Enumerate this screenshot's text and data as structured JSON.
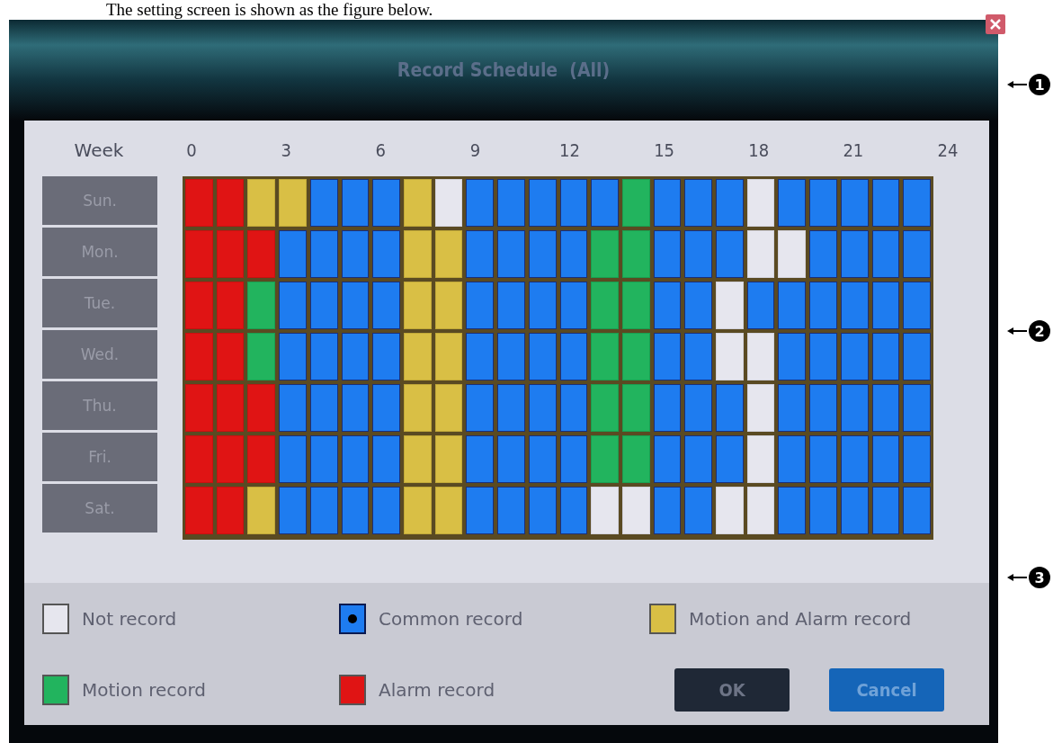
{
  "caption": "The setting screen is shown as the figure below.",
  "window": {
    "title": "Record Schedule  (All)"
  },
  "schedule": {
    "corner_label": "Week",
    "hour_labels": [
      "0",
      "3",
      "6",
      "9",
      "12",
      "15",
      "18",
      "21",
      "24"
    ],
    "rows": [
      {
        "day": "Sun.",
        "slots": [
          {
            "kind": "A"
          },
          {
            "kind": "A"
          },
          {
            "kind": "Y"
          },
          {
            "kind": "Y"
          },
          {
            "kind": "C"
          },
          {
            "kind": "C"
          },
          {
            "kind": "C"
          },
          {
            "kind": "Y"
          },
          {
            "kind": "N"
          },
          {
            "kind": "C"
          },
          {
            "kind": "C"
          },
          {
            "kind": "C"
          },
          {
            "kind": "C"
          },
          {
            "kind": "C"
          },
          {
            "kind": "G"
          },
          {
            "kind": "C"
          },
          {
            "kind": "C"
          },
          {
            "kind": "C"
          },
          {
            "kind": "N"
          },
          {
            "kind": "C"
          },
          {
            "kind": "C"
          },
          {
            "kind": "C"
          },
          {
            "kind": "C"
          },
          {
            "kind": "C"
          }
        ]
      },
      {
        "day": "Mon.",
        "slots": [
          {
            "kind": "A"
          },
          {
            "kind": "A"
          },
          {
            "kind": "A"
          },
          {
            "kind": "C"
          },
          {
            "kind": "C"
          },
          {
            "kind": "C"
          },
          {
            "kind": "C"
          },
          {
            "kind": "Y"
          },
          {
            "kind": "Y"
          },
          {
            "kind": "C"
          },
          {
            "kind": "C"
          },
          {
            "kind": "C"
          },
          {
            "kind": "C"
          },
          {
            "kind": "G"
          },
          {
            "kind": "G"
          },
          {
            "kind": "C"
          },
          {
            "kind": "C"
          },
          {
            "kind": "C"
          },
          {
            "kind": "N"
          },
          {
            "kind": "N"
          },
          {
            "kind": "C"
          },
          {
            "kind": "C"
          },
          {
            "kind": "C"
          },
          {
            "kind": "C"
          }
        ]
      },
      {
        "day": "Tue.",
        "slots": [
          {
            "kind": "A"
          },
          {
            "kind": "A"
          },
          {
            "kind": "G"
          },
          {
            "kind": "C"
          },
          {
            "kind": "C"
          },
          {
            "kind": "C"
          },
          {
            "kind": "C"
          },
          {
            "kind": "Y"
          },
          {
            "kind": "Y"
          },
          {
            "kind": "C"
          },
          {
            "kind": "C"
          },
          {
            "kind": "C"
          },
          {
            "kind": "C"
          },
          {
            "kind": "G"
          },
          {
            "kind": "G"
          },
          {
            "kind": "C"
          },
          {
            "kind": "C"
          },
          {
            "kind": "N"
          },
          {
            "kind": "C"
          },
          {
            "kind": "C"
          },
          {
            "kind": "C"
          },
          {
            "kind": "C"
          },
          {
            "kind": "C"
          },
          {
            "kind": "C"
          }
        ]
      },
      {
        "day": "Wed.",
        "slots": [
          {
            "kind": "A"
          },
          {
            "kind": "A"
          },
          {
            "kind": "G"
          },
          {
            "kind": "C"
          },
          {
            "kind": "C"
          },
          {
            "kind": "C"
          },
          {
            "kind": "C"
          },
          {
            "kind": "Y"
          },
          {
            "kind": "Y"
          },
          {
            "kind": "C"
          },
          {
            "kind": "C"
          },
          {
            "kind": "C"
          },
          {
            "kind": "C"
          },
          {
            "kind": "G"
          },
          {
            "kind": "G"
          },
          {
            "kind": "C"
          },
          {
            "kind": "C"
          },
          {
            "kind": "N"
          },
          {
            "kind": "N"
          },
          {
            "kind": "C"
          },
          {
            "kind": "C"
          },
          {
            "kind": "C"
          },
          {
            "kind": "C"
          },
          {
            "kind": "C"
          }
        ]
      },
      {
        "day": "Thu.",
        "slots": [
          {
            "kind": "A"
          },
          {
            "kind": "A"
          },
          {
            "kind": "A"
          },
          {
            "kind": "C"
          },
          {
            "kind": "C"
          },
          {
            "kind": "C"
          },
          {
            "kind": "C"
          },
          {
            "kind": "Y"
          },
          {
            "kind": "Y"
          },
          {
            "kind": "C"
          },
          {
            "kind": "C"
          },
          {
            "kind": "C"
          },
          {
            "kind": "C"
          },
          {
            "kind": "G"
          },
          {
            "kind": "G"
          },
          {
            "kind": "C"
          },
          {
            "kind": "C"
          },
          {
            "kind": "C"
          },
          {
            "kind": "N"
          },
          {
            "kind": "C"
          },
          {
            "kind": "C"
          },
          {
            "kind": "C"
          },
          {
            "kind": "C"
          },
          {
            "kind": "C"
          }
        ]
      },
      {
        "day": "Fri.",
        "slots": [
          {
            "kind": "A"
          },
          {
            "kind": "A"
          },
          {
            "kind": "A"
          },
          {
            "kind": "C"
          },
          {
            "kind": "C"
          },
          {
            "kind": "C"
          },
          {
            "kind": "C"
          },
          {
            "kind": "Y"
          },
          {
            "kind": "Y"
          },
          {
            "kind": "C"
          },
          {
            "kind": "C"
          },
          {
            "kind": "C"
          },
          {
            "kind": "C"
          },
          {
            "kind": "G"
          },
          {
            "kind": "G"
          },
          {
            "kind": "C"
          },
          {
            "kind": "C"
          },
          {
            "kind": "C"
          },
          {
            "kind": "N"
          },
          {
            "kind": "C"
          },
          {
            "kind": "C"
          },
          {
            "kind": "C"
          },
          {
            "kind": "C"
          },
          {
            "kind": "C"
          }
        ]
      },
      {
        "day": "Sat.",
        "slots": [
          {
            "kind": "A"
          },
          {
            "kind": "A"
          },
          {
            "kind": "Y"
          },
          {
            "kind": "C"
          },
          {
            "kind": "C"
          },
          {
            "kind": "C"
          },
          {
            "kind": "C"
          },
          {
            "kind": "Y"
          },
          {
            "kind": "Y"
          },
          {
            "kind": "C"
          },
          {
            "kind": "C"
          },
          {
            "kind": "C"
          },
          {
            "kind": "C"
          },
          {
            "kind": "N"
          },
          {
            "kind": "N"
          },
          {
            "kind": "C"
          },
          {
            "kind": "C"
          },
          {
            "kind": "N"
          },
          {
            "kind": "N"
          },
          {
            "kind": "C"
          },
          {
            "kind": "C"
          },
          {
            "kind": "C"
          },
          {
            "kind": "C"
          },
          {
            "kind": "C"
          }
        ]
      }
    ]
  },
  "legend": [
    {
      "kind": "N",
      "label": "Not record",
      "color": "#e6e6ee",
      "selected": false
    },
    {
      "kind": "C",
      "label": "Common record",
      "color": "#1e7cf0",
      "selected": true
    },
    {
      "kind": "Y",
      "label": "Motion and Alarm record",
      "color": "#d9bf45",
      "selected": false
    },
    {
      "kind": "G",
      "label": "Motion record",
      "color": "#22b45e",
      "selected": false
    },
    {
      "kind": "A",
      "label": "Alarm record",
      "color": "#e01414",
      "selected": false
    }
  ],
  "buttons": [
    {
      "kind": "ok",
      "label": "OK"
    },
    {
      "kind": "cancel",
      "label": "Cancel"
    }
  ],
  "callouts": [
    "1",
    "2",
    "3"
  ]
}
